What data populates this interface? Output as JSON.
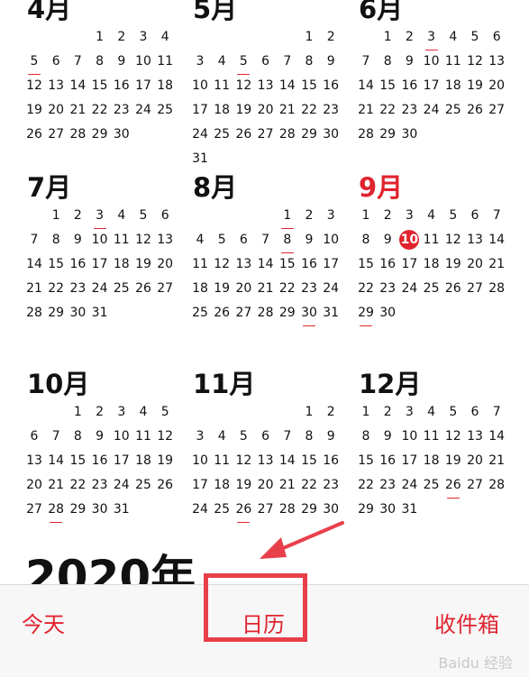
{
  "months": [
    {
      "key": "apr",
      "title": "4月",
      "days": 30,
      "start": 3,
      "events": [
        5
      ],
      "today": null,
      "current": false
    },
    {
      "key": "may",
      "title": "5月",
      "days": 31,
      "start": 5,
      "events": [
        5
      ],
      "today": null,
      "current": false
    },
    {
      "key": "jun",
      "title": "6月",
      "days": 30,
      "start": 1,
      "events": [
        3
      ],
      "today": null,
      "current": false
    },
    {
      "key": "jul",
      "title": "7月",
      "days": 31,
      "start": 1,
      "events": [
        3
      ],
      "today": null,
      "current": false
    },
    {
      "key": "aug",
      "title": "8月",
      "days": 31,
      "start": 4,
      "events": [
        1,
        8,
        30
      ],
      "today": null,
      "current": false
    },
    {
      "key": "sep",
      "title": "9月",
      "days": 30,
      "start": 0,
      "events": [
        29
      ],
      "today": 10,
      "current": true
    },
    {
      "key": "oct",
      "title": "10月",
      "days": 31,
      "start": 2,
      "events": [
        28
      ],
      "today": null,
      "current": false
    },
    {
      "key": "nov",
      "title": "11月",
      "days": 30,
      "start": 5,
      "events": [
        26
      ],
      "today": null,
      "current": false
    },
    {
      "key": "dec",
      "title": "12月",
      "days": 31,
      "start": 0,
      "events": [
        26
      ],
      "today": null,
      "current": false
    }
  ],
  "next_year_partial": "2020年",
  "tabbar": {
    "today_label": "今天",
    "calendars_label": "日历",
    "inbox_label": "收件箱"
  },
  "watermark": "Baidu 经验",
  "colors": {
    "accent": "#e0242f",
    "highlight_box": "#e8404a"
  }
}
